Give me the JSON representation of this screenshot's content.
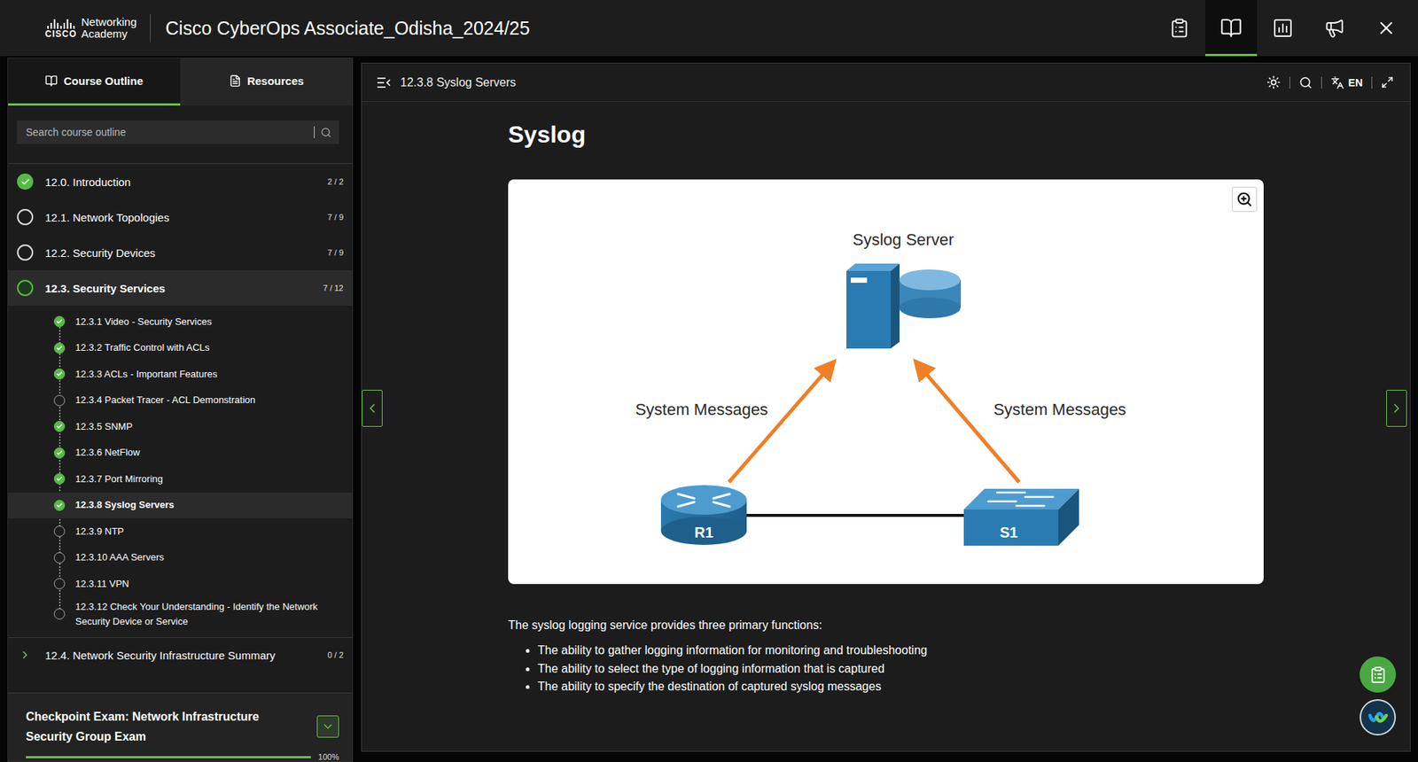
{
  "header": {
    "brand": "CISCO",
    "logo_lines": [
      "Networking",
      "Academy"
    ],
    "title": "Cisco CyberOps Associate_Odisha_2024/25",
    "toolbar": [
      {
        "selected": false
      },
      {
        "selected": true
      },
      {
        "selected": false
      },
      {
        "selected": false
      },
      {
        "selected": false
      }
    ]
  },
  "sidebar": {
    "tabs": [
      {
        "label": "Course Outline",
        "selected": true
      },
      {
        "label": "Resources",
        "selected": false
      }
    ],
    "search": {
      "placeholder": "Search course outline"
    },
    "sections": [
      {
        "label": "12.0. Introduction",
        "count": "2 / 2",
        "kind": "section",
        "status": "complete",
        "expanded": false,
        "items": []
      },
      {
        "label": "12.1. Network Topologies",
        "count": "7 / 9",
        "kind": "section",
        "status": "partial",
        "expanded": false,
        "items": []
      },
      {
        "label": "12.2. Security Devices",
        "count": "7 / 9",
        "kind": "section",
        "status": "partial",
        "expanded": false,
        "items": []
      },
      {
        "label": "12.3. Security Services",
        "count": "7 / 12",
        "kind": "section",
        "status": "active",
        "expanded": true,
        "items": [
          {
            "label": "12.3.1 Video - Security Services",
            "complete": true,
            "selected": false
          },
          {
            "label": "12.3.2 Traffic Control with ACLs",
            "complete": true,
            "selected": false
          },
          {
            "label": "12.3.3 ACLs - Important Features",
            "complete": true,
            "selected": false
          },
          {
            "label": "12.3.4 Packet Tracer - ACL Demonstration",
            "complete": false,
            "selected": false
          },
          {
            "label": "12.3.5 SNMP",
            "complete": true,
            "selected": false
          },
          {
            "label": "12.3.6 NetFlow",
            "complete": true,
            "selected": false
          },
          {
            "label": "12.3.7 Port Mirroring",
            "complete": true,
            "selected": false
          },
          {
            "label": "12.3.8 Syslog Servers",
            "complete": true,
            "selected": true
          },
          {
            "label": "12.3.9 NTP",
            "complete": false,
            "selected": false
          },
          {
            "label": "12.3.10 AAA Servers",
            "complete": false,
            "selected": false
          },
          {
            "label": "12.3.11 VPN",
            "complete": false,
            "selected": false
          },
          {
            "label": "12.3.12 Check Your Understanding - Identify the Network Security Device or Service",
            "complete": false,
            "selected": false
          }
        ]
      },
      {
        "label": "12.4. Network Security Infrastructure Summary",
        "count": "0 / 2",
        "kind": "group",
        "status": "none",
        "expanded": false,
        "items": []
      }
    ],
    "checkpoint": {
      "title": "Checkpoint Exam: Network Infrastructure Security Group Exam",
      "progress": "100%",
      "level": 1,
      "expanded": false
    }
  },
  "content": {
    "breadcrumb": "12.3.8 Syslog Servers",
    "language": "EN",
    "heading": "Syslog",
    "figure": {
      "server": "Syslog Server",
      "left_label": "System Messages",
      "right_label": "System Messages",
      "router": "R1",
      "switch": "S1"
    },
    "intro": "The syslog logging service provides three primary functions:",
    "bullets": [
      "The ability to gather logging information for monitoring and troubleshooting",
      "The ability to select the type of logging information that is captured",
      "The ability to specify the destination of captured syslog messages"
    ]
  }
}
